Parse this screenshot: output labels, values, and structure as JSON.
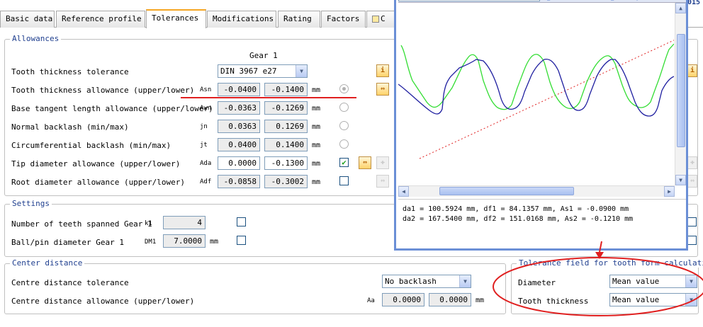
{
  "tabs": [
    "Basic data",
    "Reference profile",
    "Tolerances",
    "Modifications",
    "Rating",
    "Factors",
    "C"
  ],
  "top_right_fragment": "015",
  "allowances": {
    "legend": "Allowances",
    "gear_header": "Gear 1",
    "rows": [
      {
        "label": "Tooth thickness tolerance",
        "select": "DIN 3967 e27"
      },
      {
        "label": "Tooth thickness allowance (upper/lower)",
        "symbol": "Asn",
        "v1": "-0.0400",
        "v2": "-0.1400",
        "unit": "mm"
      },
      {
        "label": "Base tangent length allowance (upper/lower)",
        "symbol": "Awn",
        "v1": "-0.0363",
        "v2": "-0.1269",
        "unit": "mm"
      },
      {
        "label": "Normal backlash (min/max)",
        "symbol": "jn",
        "v1": "0.0363",
        "v2": "0.1269",
        "unit": "mm"
      },
      {
        "label": "Circumferential backlash (min/max)",
        "symbol": "jt",
        "v1": "0.0400",
        "v2": "0.1400",
        "unit": "mm"
      },
      {
        "label": "Tip diameter allowance (upper/lower)",
        "symbol": "Ada",
        "v1": "0.0000",
        "v2": "-0.1300",
        "unit": "mm"
      },
      {
        "label": "Root diameter allowance (upper/lower)",
        "symbol": "Adf",
        "v1": "-0.0858",
        "v2": "-0.3002",
        "unit": "mm"
      }
    ]
  },
  "settings": {
    "legend": "Settings",
    "teeth_label": "Number of teeth spanned Gear 1",
    "teeth_symbol": "k1",
    "teeth_value": "4",
    "ball_label": "Ball/pin diameter Gear 1",
    "ball_symbol": "DM1",
    "ball_value": "7.0000",
    "ball_unit": "mm"
  },
  "center": {
    "legend": "Center distance",
    "tol_label": "Centre distance tolerance",
    "tol_select": "No backlash",
    "allow_label": "Centre distance allowance (upper/lower)",
    "allow_symbol": "Aa",
    "v1": "0.0000",
    "v2": "0.0000",
    "unit": "mm"
  },
  "tolerance_field": {
    "legend": "Tolerance field for tooth form calculation",
    "diameter_label": "Diameter",
    "diameter_value": "Mean value",
    "thickness_label": "Tooth thickness",
    "thickness_value": "Mean value"
  },
  "popup": {
    "line1": "da1 = 100.5924 mm, df1 = 84.1357 mm, As1 = -0.0900 mm",
    "line2": "da2 = 167.5400 mm, df2 = 151.0168 mm, As2 = -0.1210 mm"
  },
  "colors": {
    "gear1": "#1f1fa0",
    "gear2": "#33dd33",
    "annotation": "#e02020",
    "legend_text": "#1f3f8f"
  }
}
